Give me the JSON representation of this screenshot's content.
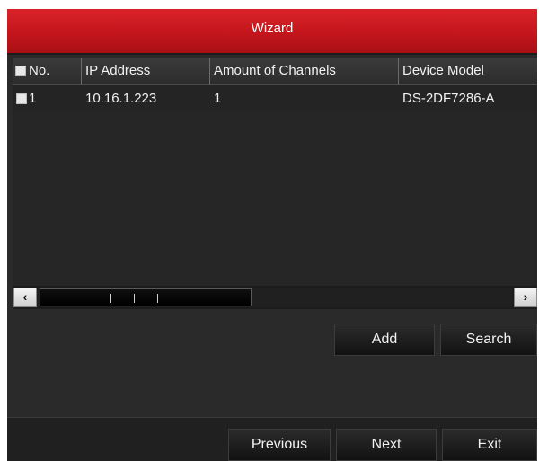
{
  "window": {
    "title": "Wizard"
  },
  "table": {
    "columns": [
      "No.",
      "IP Address",
      "Amount of Channels",
      "Device Model"
    ],
    "rows": [
      {
        "no": "1",
        "ip": "10.16.1.223",
        "channels": "1",
        "model": "DS-2DF7286-A"
      }
    ]
  },
  "scrollbar": {
    "left_arrow": "‹",
    "right_arrow": "›"
  },
  "actions": {
    "add_label": "Add",
    "search_label": "Search"
  },
  "footer": {
    "previous_label": "Previous",
    "next_label": "Next",
    "exit_label": "Exit"
  },
  "colors": {
    "title_bar": "#c4161c",
    "panel_bg": "#2a2a2a",
    "text": "#f2f2f2"
  }
}
